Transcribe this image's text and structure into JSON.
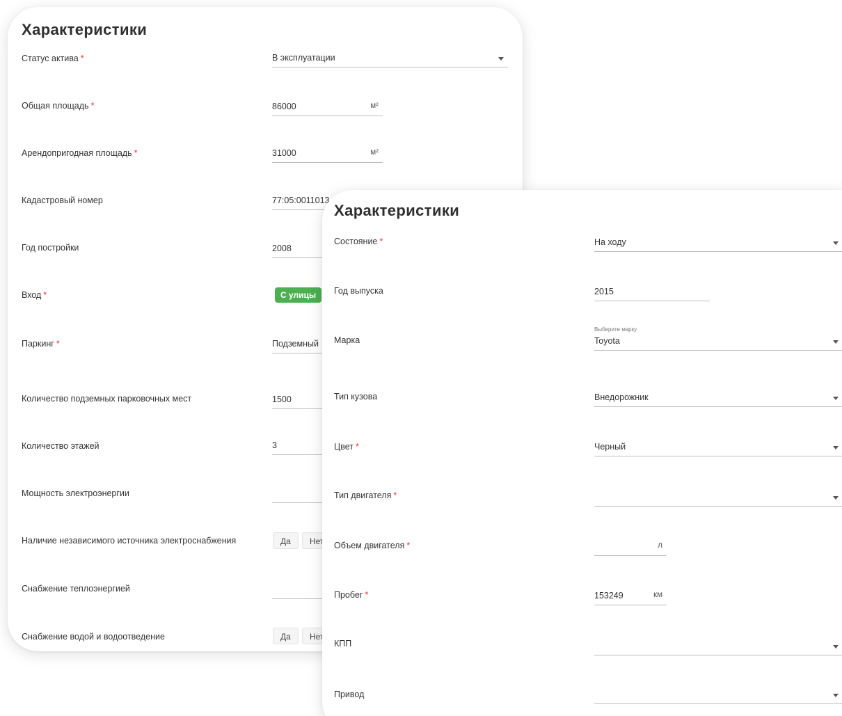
{
  "card1": {
    "title": "Характеристики",
    "asset_status": {
      "label": "Статус актива",
      "value": "В эксплуатации"
    },
    "total_area": {
      "label": "Общая площадь",
      "value": "86000",
      "unit": "м²"
    },
    "rentable_area": {
      "label": "Арендопригодная площадь",
      "value": "31000",
      "unit": "м²"
    },
    "cadastral_number": {
      "label": "Кадастровый номер",
      "value": "77:05:0011013"
    },
    "build_year": {
      "label": "Год постройки",
      "value": "2008"
    },
    "entrance": {
      "label": "Вход",
      "chip": "С улицы"
    },
    "parking": {
      "label": "Паркинг",
      "value": "Подземный"
    },
    "underground_spots": {
      "label": "Количество подземных парковочных мест",
      "value": "1500"
    },
    "floors": {
      "label": "Количество этажей",
      "value": "3"
    },
    "power": {
      "label": "Мощность электроэнергии",
      "value": ""
    },
    "independent_power": {
      "label": "Наличие независимого источника электроснабжения",
      "yes": "Да",
      "no": "Нет"
    },
    "heat_supply": {
      "label": "Снабжение теплоэнергией",
      "value": ""
    },
    "water_supply": {
      "label": "Снабжение водой и водоотведение",
      "yes": "Да",
      "no": "Нет"
    }
  },
  "card2": {
    "title": "Характеристики",
    "condition": {
      "label": "Состояние",
      "value": "На ходу"
    },
    "release_year": {
      "label": "Год выпуска",
      "value": "2015"
    },
    "brand": {
      "label": "Марка",
      "float_label": "Выберите марку",
      "value": "Toyota"
    },
    "body_type": {
      "label": "Тип кузова",
      "value": "Внедорожник"
    },
    "color": {
      "label": "Цвет",
      "value": "Черный"
    },
    "engine_type": {
      "label": "Тип двигателя",
      "value": ""
    },
    "engine_volume": {
      "label": "Объем двигателя",
      "value": "",
      "unit": "л"
    },
    "mileage": {
      "label": "Пробег",
      "value": "153249",
      "unit": "км"
    },
    "gearbox": {
      "label": "КПП",
      "value": ""
    },
    "drive": {
      "label": "Привод",
      "value": ""
    }
  },
  "required_mark": "*",
  "colors": {
    "required": "#e53935",
    "chip": "#4caf50",
    "underline": "#bdbdbd"
  }
}
